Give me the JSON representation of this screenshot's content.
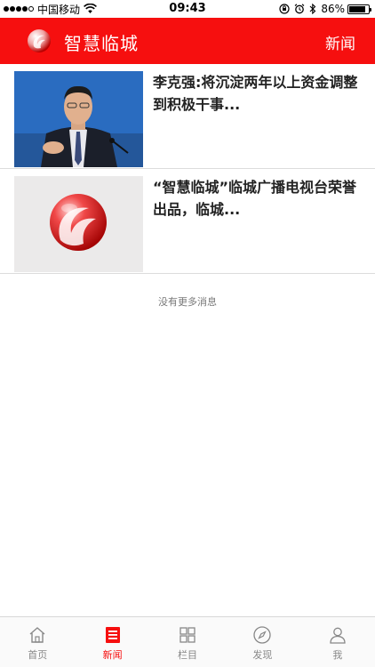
{
  "status_bar": {
    "carrier": "中国移动",
    "time": "09:43",
    "battery": "86%",
    "battery_level": 0.86
  },
  "header": {
    "title": "智慧临城",
    "right_label": "新闻"
  },
  "news": [
    {
      "title": "李克强:将沉淀两年以上资金调整到积极干事...",
      "thumb_icon": "person-photo"
    },
    {
      "title": "“智慧临城”临城广播电视台荣誉出品，临城...",
      "thumb_icon": "logo-image"
    }
  ],
  "footer_message": "没有更多消息",
  "tabs": [
    {
      "label": "首页",
      "icon": "home-icon",
      "active": false
    },
    {
      "label": "新闻",
      "icon": "news-icon",
      "active": true
    },
    {
      "label": "栏目",
      "icon": "grid-icon",
      "active": false
    },
    {
      "label": "发现",
      "icon": "compass-icon",
      "active": false
    },
    {
      "label": "我",
      "icon": "user-icon",
      "active": false
    }
  ],
  "colors": {
    "brand_red": "#f60f0f",
    "inactive_tab": "#888888"
  }
}
